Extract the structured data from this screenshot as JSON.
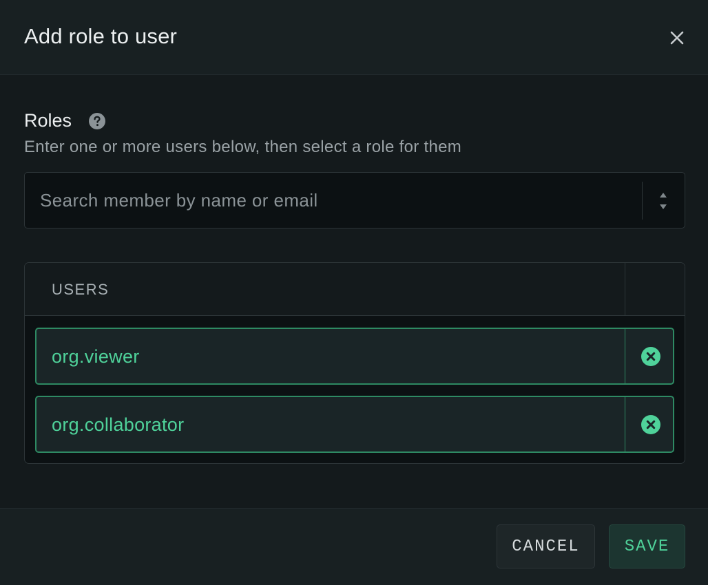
{
  "dialog": {
    "title": "Add role to user",
    "close_icon": "close-icon"
  },
  "roles": {
    "label": "Roles",
    "help_icon": "question-circle-icon",
    "description": "Enter one or more users below, then select a role for them"
  },
  "search": {
    "placeholder": "Search member by name or email",
    "value": "",
    "arrows_icon": "chevron-up-down-icon"
  },
  "users_table": {
    "header": "USERS",
    "rows": [
      {
        "label": "org.viewer",
        "remove_icon": "remove-circle-x-icon"
      },
      {
        "label": "org.collaborator",
        "remove_icon": "remove-circle-x-icon"
      }
    ]
  },
  "footer": {
    "cancel_label": "CANCEL",
    "save_label": "SAVE"
  },
  "colors": {
    "accent": "#4fd29a",
    "accent_border": "#2e8a63",
    "background": "#141a1c",
    "text_primary": "#eceff0",
    "text_secondary": "#9aa2a6"
  }
}
